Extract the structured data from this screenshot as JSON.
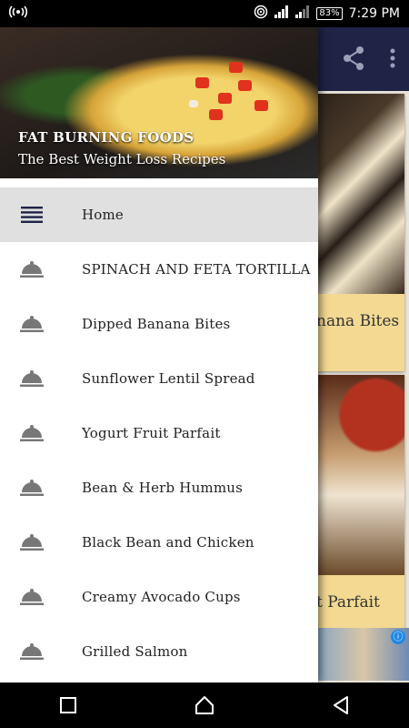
{
  "status_bar": {
    "battery": "83%",
    "time": "7:29 PM",
    "icons": [
      "cast-icon",
      "hotspot-icon",
      "signal-icon",
      "battery-icon"
    ]
  },
  "toolbar": {
    "color": "#1f2346",
    "actions": [
      "share-icon",
      "more-vert-icon"
    ]
  },
  "background_cards": [
    {
      "caption": "nana Bites"
    },
    {
      "caption": "t Parfait"
    }
  ],
  "ad": {
    "info_icon": "ⓘ"
  },
  "drawer": {
    "header": {
      "title": "FAT BURNING FOODS",
      "subtitle": "The Best Weight Loss Recipes"
    },
    "items": [
      {
        "label": "Home",
        "icon": "menu-list-icon",
        "active": true
      },
      {
        "label": "SPINACH AND FETA TORTILLA",
        "icon": "cloche-icon"
      },
      {
        "label": "Dipped Banana Bites",
        "icon": "cloche-icon"
      },
      {
        "label": "Sunflower Lentil Spread",
        "icon": "cloche-icon"
      },
      {
        "label": "Yogurt Fruit Parfait",
        "icon": "cloche-icon"
      },
      {
        "label": "Bean & Herb Hummus",
        "icon": "cloche-icon"
      },
      {
        "label": "Black Bean and Chicken",
        "icon": "cloche-icon"
      },
      {
        "label": "Creamy Avocado Cups",
        "icon": "cloche-icon"
      },
      {
        "label": "Grilled Salmon",
        "icon": "cloche-icon"
      }
    ]
  },
  "nav_bar": [
    "recents-icon",
    "home-icon",
    "back-icon"
  ]
}
